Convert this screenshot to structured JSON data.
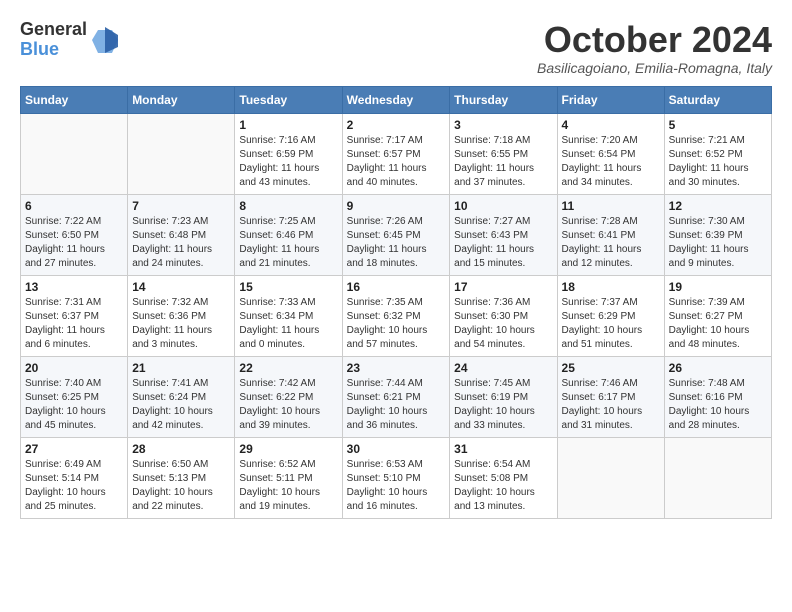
{
  "header": {
    "logo_general": "General",
    "logo_blue": "Blue",
    "month_title": "October 2024",
    "location": "Basilicagoiano, Emilia-Romagna, Italy"
  },
  "calendar": {
    "days_of_week": [
      "Sunday",
      "Monday",
      "Tuesday",
      "Wednesday",
      "Thursday",
      "Friday",
      "Saturday"
    ],
    "weeks": [
      [
        {
          "day": "",
          "info": ""
        },
        {
          "day": "",
          "info": ""
        },
        {
          "day": "1",
          "info": "Sunrise: 7:16 AM\nSunset: 6:59 PM\nDaylight: 11 hours and 43 minutes."
        },
        {
          "day": "2",
          "info": "Sunrise: 7:17 AM\nSunset: 6:57 PM\nDaylight: 11 hours and 40 minutes."
        },
        {
          "day": "3",
          "info": "Sunrise: 7:18 AM\nSunset: 6:55 PM\nDaylight: 11 hours and 37 minutes."
        },
        {
          "day": "4",
          "info": "Sunrise: 7:20 AM\nSunset: 6:54 PM\nDaylight: 11 hours and 34 minutes."
        },
        {
          "day": "5",
          "info": "Sunrise: 7:21 AM\nSunset: 6:52 PM\nDaylight: 11 hours and 30 minutes."
        }
      ],
      [
        {
          "day": "6",
          "info": "Sunrise: 7:22 AM\nSunset: 6:50 PM\nDaylight: 11 hours and 27 minutes."
        },
        {
          "day": "7",
          "info": "Sunrise: 7:23 AM\nSunset: 6:48 PM\nDaylight: 11 hours and 24 minutes."
        },
        {
          "day": "8",
          "info": "Sunrise: 7:25 AM\nSunset: 6:46 PM\nDaylight: 11 hours and 21 minutes."
        },
        {
          "day": "9",
          "info": "Sunrise: 7:26 AM\nSunset: 6:45 PM\nDaylight: 11 hours and 18 minutes."
        },
        {
          "day": "10",
          "info": "Sunrise: 7:27 AM\nSunset: 6:43 PM\nDaylight: 11 hours and 15 minutes."
        },
        {
          "day": "11",
          "info": "Sunrise: 7:28 AM\nSunset: 6:41 PM\nDaylight: 11 hours and 12 minutes."
        },
        {
          "day": "12",
          "info": "Sunrise: 7:30 AM\nSunset: 6:39 PM\nDaylight: 11 hours and 9 minutes."
        }
      ],
      [
        {
          "day": "13",
          "info": "Sunrise: 7:31 AM\nSunset: 6:37 PM\nDaylight: 11 hours and 6 minutes."
        },
        {
          "day": "14",
          "info": "Sunrise: 7:32 AM\nSunset: 6:36 PM\nDaylight: 11 hours and 3 minutes."
        },
        {
          "day": "15",
          "info": "Sunrise: 7:33 AM\nSunset: 6:34 PM\nDaylight: 11 hours and 0 minutes."
        },
        {
          "day": "16",
          "info": "Sunrise: 7:35 AM\nSunset: 6:32 PM\nDaylight: 10 hours and 57 minutes."
        },
        {
          "day": "17",
          "info": "Sunrise: 7:36 AM\nSunset: 6:30 PM\nDaylight: 10 hours and 54 minutes."
        },
        {
          "day": "18",
          "info": "Sunrise: 7:37 AM\nSunset: 6:29 PM\nDaylight: 10 hours and 51 minutes."
        },
        {
          "day": "19",
          "info": "Sunrise: 7:39 AM\nSunset: 6:27 PM\nDaylight: 10 hours and 48 minutes."
        }
      ],
      [
        {
          "day": "20",
          "info": "Sunrise: 7:40 AM\nSunset: 6:25 PM\nDaylight: 10 hours and 45 minutes."
        },
        {
          "day": "21",
          "info": "Sunrise: 7:41 AM\nSunset: 6:24 PM\nDaylight: 10 hours and 42 minutes."
        },
        {
          "day": "22",
          "info": "Sunrise: 7:42 AM\nSunset: 6:22 PM\nDaylight: 10 hours and 39 minutes."
        },
        {
          "day": "23",
          "info": "Sunrise: 7:44 AM\nSunset: 6:21 PM\nDaylight: 10 hours and 36 minutes."
        },
        {
          "day": "24",
          "info": "Sunrise: 7:45 AM\nSunset: 6:19 PM\nDaylight: 10 hours and 33 minutes."
        },
        {
          "day": "25",
          "info": "Sunrise: 7:46 AM\nSunset: 6:17 PM\nDaylight: 10 hours and 31 minutes."
        },
        {
          "day": "26",
          "info": "Sunrise: 7:48 AM\nSunset: 6:16 PM\nDaylight: 10 hours and 28 minutes."
        }
      ],
      [
        {
          "day": "27",
          "info": "Sunrise: 6:49 AM\nSunset: 5:14 PM\nDaylight: 10 hours and 25 minutes."
        },
        {
          "day": "28",
          "info": "Sunrise: 6:50 AM\nSunset: 5:13 PM\nDaylight: 10 hours and 22 minutes."
        },
        {
          "day": "29",
          "info": "Sunrise: 6:52 AM\nSunset: 5:11 PM\nDaylight: 10 hours and 19 minutes."
        },
        {
          "day": "30",
          "info": "Sunrise: 6:53 AM\nSunset: 5:10 PM\nDaylight: 10 hours and 16 minutes."
        },
        {
          "day": "31",
          "info": "Sunrise: 6:54 AM\nSunset: 5:08 PM\nDaylight: 10 hours and 13 minutes."
        },
        {
          "day": "",
          "info": ""
        },
        {
          "day": "",
          "info": ""
        }
      ]
    ]
  }
}
